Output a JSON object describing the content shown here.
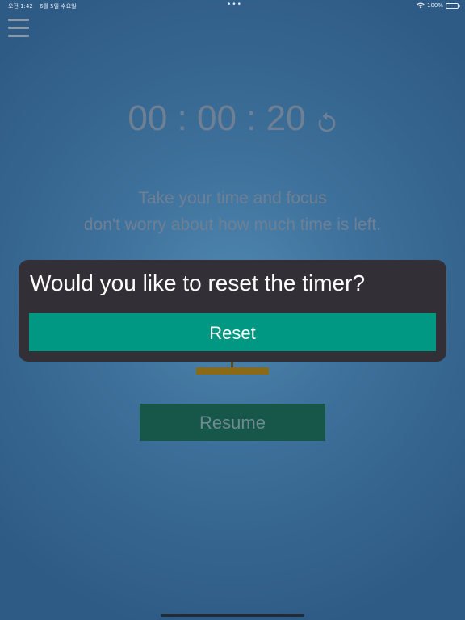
{
  "status_bar": {
    "time": "오전 1:42",
    "date": "6월 5일 수요일",
    "dots": "•••",
    "battery": "100%"
  },
  "timer": {
    "display": "00 : 00 : 20"
  },
  "motivation": {
    "line1": "Take your time and focus",
    "line2": "don't worry about how much time is left."
  },
  "controls": {
    "resume_label": "Resume"
  },
  "dialog": {
    "title": "Would you like to reset the timer?",
    "reset_label": "Reset"
  },
  "colors": {
    "dialog_bg": "#322f36",
    "reset_button": "#009882",
    "resume_button": "#17574a",
    "background": "#3c6f99"
  }
}
